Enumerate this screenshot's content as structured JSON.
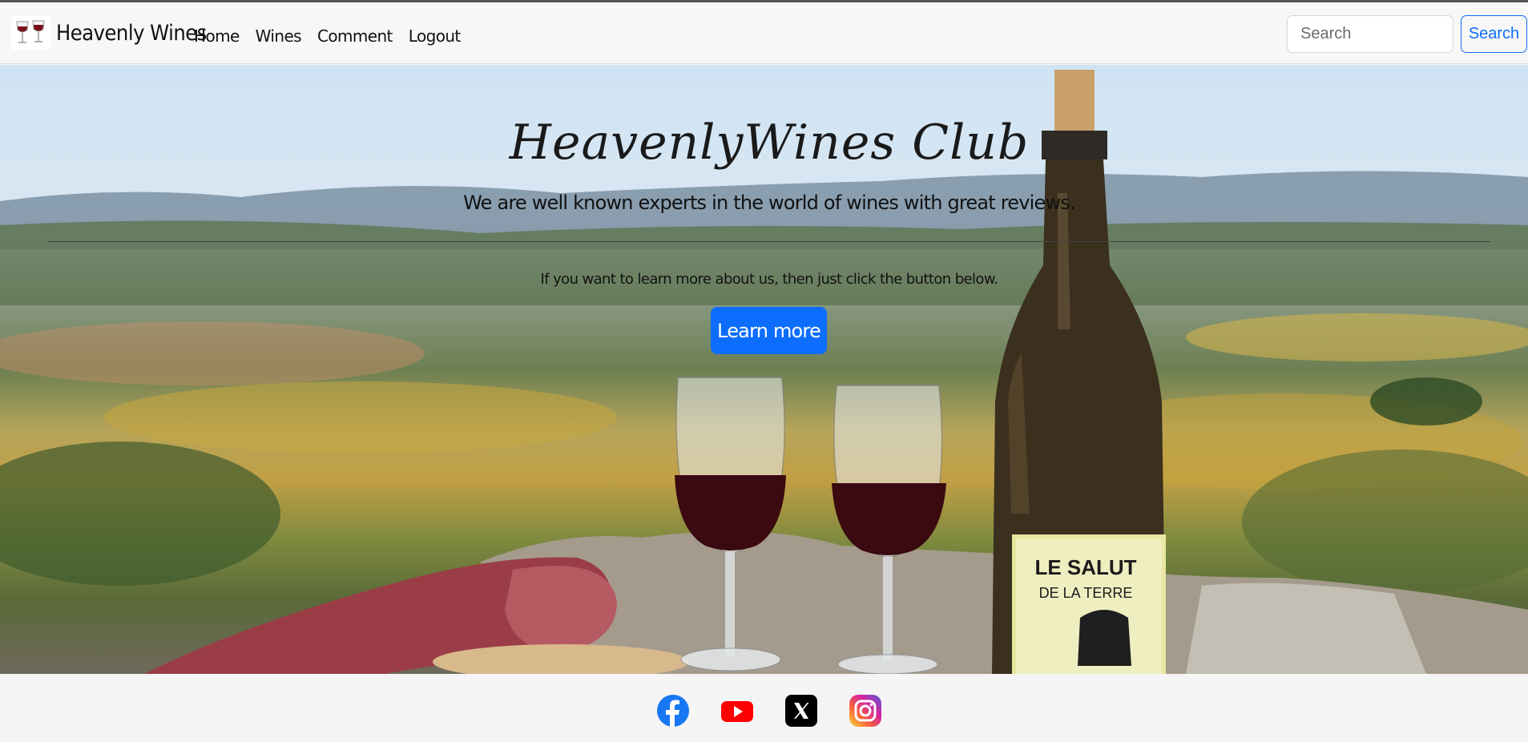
{
  "navbar": {
    "brand": "Heavenly Wines",
    "logo_icon": "wine-glasses-icon",
    "links": [
      "Home",
      "Wines",
      "Comment",
      "Logout"
    ],
    "search": {
      "placeholder": "Search",
      "button_label": "Search"
    }
  },
  "hero": {
    "title": "HeavenlyWines Club",
    "subtitle": "We are well known experts in the world of wines with great reviews.",
    "lead": "If you want to learn more about us, then just click the button below.",
    "button_label": "Learn more",
    "bottle_label": [
      "LE SALUT",
      "DE LA TERRE"
    ]
  },
  "footer": {
    "social": [
      {
        "icon": "facebook-icon",
        "color": "#1877f2"
      },
      {
        "icon": "youtube-icon",
        "color": "#ff0000"
      },
      {
        "icon": "x-icon",
        "color": "#000000"
      },
      {
        "icon": "instagram-icon",
        "color": "#d6249f"
      }
    ]
  },
  "colors": {
    "primary": "#0d6efd",
    "navbar_bg": "#f7f7f7"
  }
}
